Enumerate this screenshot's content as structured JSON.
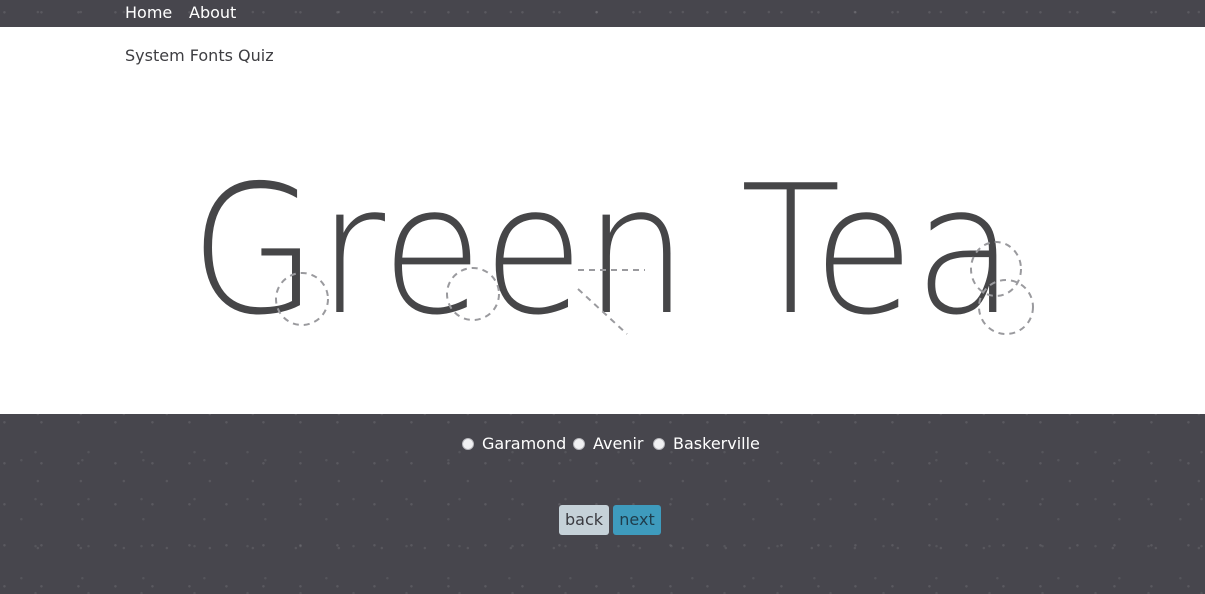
{
  "nav": {
    "home_label": "Home",
    "about_label": "About"
  },
  "page": {
    "title": "System Fonts Quiz"
  },
  "specimen": {
    "text": "Green Tea",
    "color": "#464648",
    "annotation_color": "#9a9a9e"
  },
  "quiz": {
    "options": [
      {
        "label": "Garamond"
      },
      {
        "label": "Avenir"
      },
      {
        "label": "Baskerville"
      }
    ]
  },
  "buttons": {
    "back_label": "back",
    "next_label": "next"
  },
  "colors": {
    "background": "#47464d",
    "card": "#ffffff",
    "back_button": "#c5d1d8",
    "next_button": "#3e9bbd"
  }
}
